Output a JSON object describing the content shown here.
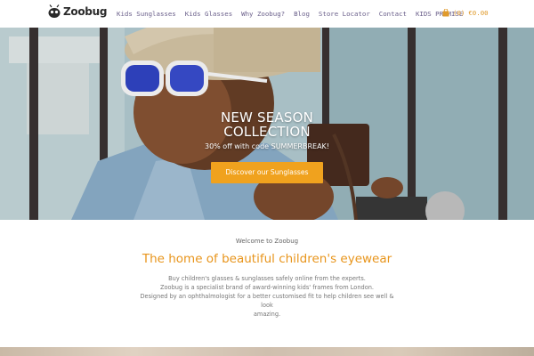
{
  "brand": {
    "name": "Zoobug"
  },
  "nav": {
    "items": [
      "Kids Sunglasses",
      "Kids Glasses",
      "Why Zoobug?",
      "Blog",
      "Store Locator",
      "Contact",
      "KIDS PROMISE"
    ]
  },
  "cart": {
    "count": "(0)",
    "total": "€0.00",
    "icon": "shopping-bag-icon"
  },
  "hero": {
    "title_line1": "NEW SEASON",
    "title_line2": "COLLECTION",
    "subtitle": "30% off with code SUMMERBREAK!",
    "cta_label": "Discover our Sunglasses"
  },
  "intro": {
    "welcome": "Welcome to Zoobug",
    "headline": "The home of beautiful children's eyewear",
    "lines": [
      "Buy children's glasses & sunglasses safely online from the experts.",
      "Zoobug is a specialist brand of award-winning kids' frames from London.",
      "Designed by an ophthalmologist for a better customised fit to help children see well & look",
      "amazing."
    ]
  },
  "colors": {
    "accent": "#f0a21e",
    "headline": "#e8951c",
    "nav_text": "#6a5f8a"
  }
}
